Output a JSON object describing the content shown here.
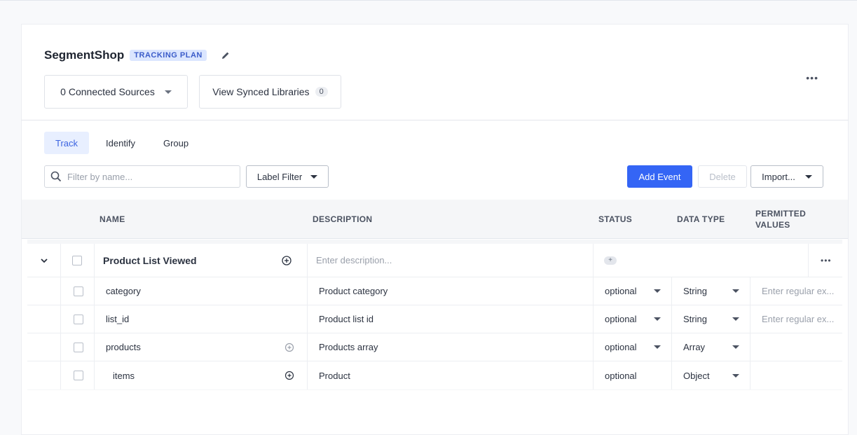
{
  "header": {
    "workspace_title": "SegmentShop",
    "plan_badge": "TRACKING PLAN",
    "connected_sources_label": "0 Connected Sources",
    "synced_libraries_label": "View Synced Libraries",
    "synced_libraries_count": "0"
  },
  "tabs": [
    {
      "label": "Track",
      "active": true
    },
    {
      "label": "Identify",
      "active": false
    },
    {
      "label": "Group",
      "active": false
    }
  ],
  "toolbar": {
    "filter_placeholder": "Filter by name...",
    "label_filter": "Label Filter",
    "add_event": "Add Event",
    "delete": "Delete",
    "import": "Import..."
  },
  "table": {
    "columns": {
      "name": "NAME",
      "description": "DESCRIPTION",
      "status": "STATUS",
      "data_type": "DATA TYPE",
      "permitted_values_line1": "PERMITTED",
      "permitted_values_line2": "VALUES"
    },
    "event": {
      "name": "Product List Viewed",
      "description_placeholder": "Enter description...",
      "status_add": "+"
    },
    "properties": [
      {
        "name": "category",
        "description": "Product category",
        "status": "optional",
        "type": "String",
        "regex_placeholder": "Enter regular ex..."
      },
      {
        "name": "list_id",
        "description": "Product list id",
        "status": "optional",
        "type": "String",
        "regex_placeholder": "Enter regular ex..."
      },
      {
        "name": "products",
        "description": "Products array",
        "status": "optional",
        "type": "Array",
        "regex_placeholder": ""
      },
      {
        "name": "items",
        "description": "Product",
        "status": "optional",
        "type": "Object",
        "regex_placeholder": ""
      }
    ]
  },
  "colors": {
    "primary": "#3465f5",
    "badge_bg": "#dbe6ff",
    "badge_text": "#3b5cc9",
    "tab_active_bg": "#e8efff"
  }
}
